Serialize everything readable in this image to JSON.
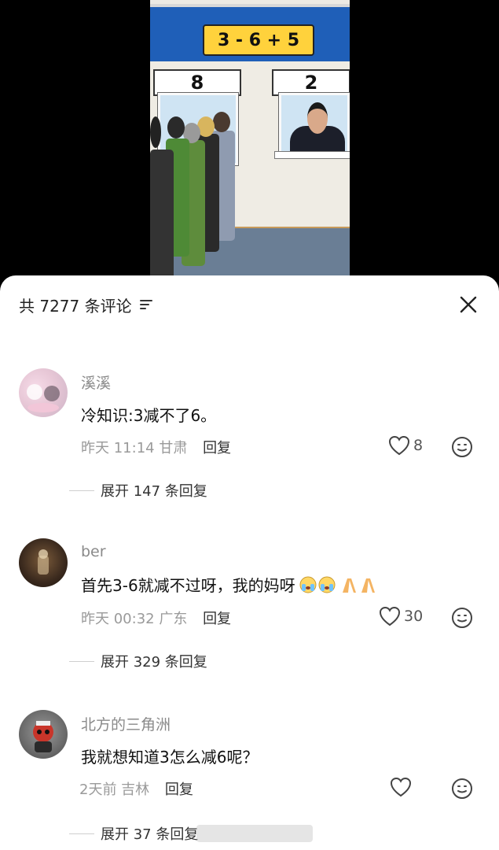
{
  "video": {
    "equation": "3 - 6 + 5",
    "left_sign": "8",
    "right_sign": "2"
  },
  "comments_panel": {
    "title": "共 7277 条评论",
    "comments": [
      {
        "username": "溪溪",
        "text": "冷知识:3减不了6。",
        "time": "昨天 11:14 甘肃",
        "reply_label": "回复",
        "likes": "8",
        "expand_label": "展开 147 条回复"
      },
      {
        "username": "ber",
        "text": "首先3-6就减不过呀，我的妈呀",
        "time": "昨天 00:32 广东",
        "reply_label": "回复",
        "likes": "30",
        "expand_label": "展开 329 条回复"
      },
      {
        "username": "北方的三角洲",
        "text": "我就想知道3怎么减6呢？",
        "time": "2天前 吉林",
        "reply_label": "回复",
        "likes": "",
        "expand_label": "展开 37 条回复"
      }
    ]
  },
  "icons": {
    "filter": "filter-icon",
    "close": "close-icon",
    "like": "heart-icon",
    "emoji": "emoji-face-icon"
  }
}
